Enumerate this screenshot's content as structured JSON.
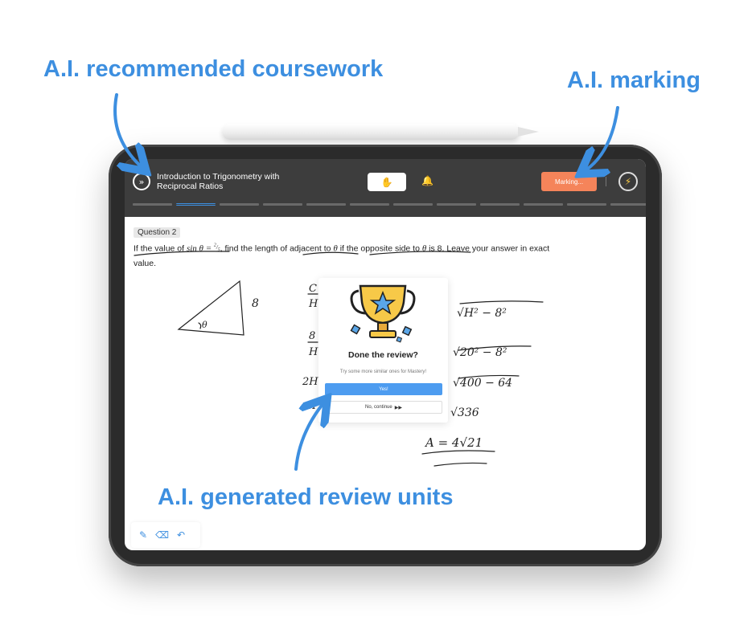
{
  "annotations": {
    "coursework": "A.I. recommended coursework",
    "marking": "A.I. marking",
    "review": "A.I. generated review units"
  },
  "header": {
    "course_title": "Introduction to Trigonometry with Reciprocal Ratios",
    "marking_label": "Marking...",
    "progress_segments": 12,
    "active_segment": 1
  },
  "question": {
    "label": "Question 2",
    "text_1": "If the value of ",
    "math_sin": "sin θ = ",
    "frac_num": "2",
    "frac_den": "5",
    "text_2": ", find the length of adjacent to ",
    "theta": "θ",
    "text_3": " if the opposite side to ",
    "text_4": " is 8. Leave your answer in exact value."
  },
  "modal": {
    "title": "Done the review?",
    "subtitle": "Try some more similar ones for Mastery!",
    "yes_label": "Yes!",
    "no_label": "No, continue"
  },
  "handwriting": {
    "triangle_side": "8",
    "triangle_angle": "θ",
    "fractions": [
      "C\nH",
      "8\nH",
      "2H",
      "H"
    ],
    "work_lines": [
      "√H² − 8²",
      "√20² − 8²",
      "√400 − 64",
      "√336",
      "A = 4√21"
    ]
  },
  "colors": {
    "accent": "#3d8fe0",
    "marking": "#f5845a",
    "header_bg": "#3d3d3d"
  },
  "icons": {
    "nav": "double-chevron-icon",
    "hand": "hand-icon",
    "bell": "bell-icon",
    "power": "lightning-icon",
    "pen": "pen-icon",
    "eraser": "eraser-icon",
    "undo": "undo-icon"
  }
}
